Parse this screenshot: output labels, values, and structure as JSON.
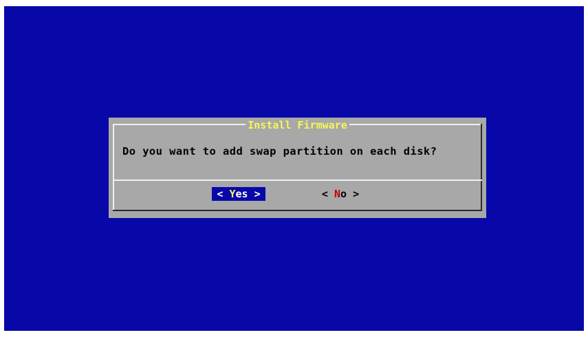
{
  "dialog": {
    "title": "Install Firmware",
    "message": "Do you want to add swap partition on each disk?"
  },
  "buttons": {
    "yes": {
      "open": "<",
      "hotkey": "Y",
      "rest": "es",
      "close": ">"
    },
    "no": {
      "open": "<",
      "hotkey": "N",
      "rest": "o",
      "close": ">"
    }
  },
  "colors": {
    "screen_bg": "#0808a8",
    "dialog_bg": "#a8a8a8",
    "title_fg": "#f6f656",
    "hotkey_no": "#c40000",
    "selected_bg": "#0808a8"
  }
}
